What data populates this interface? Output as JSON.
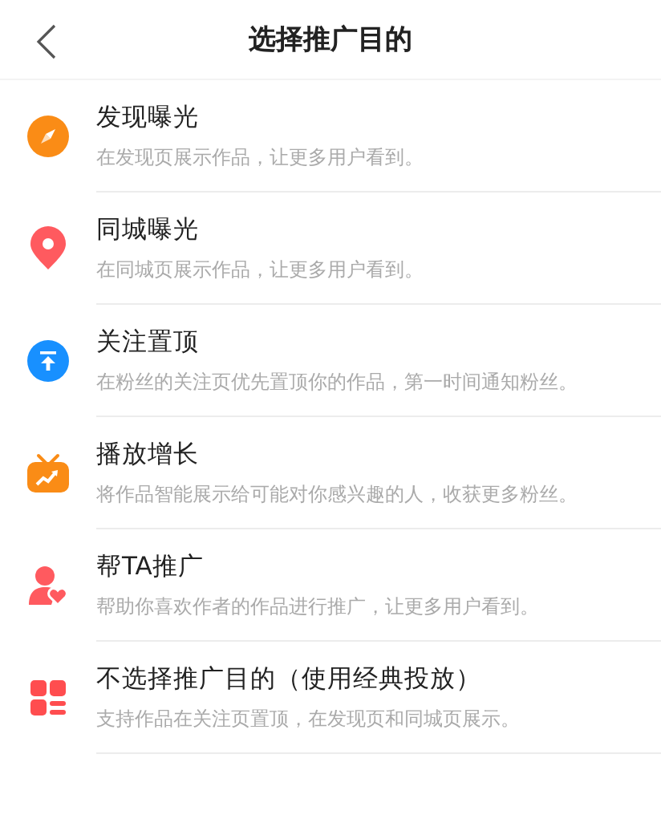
{
  "header": {
    "title": "选择推广目的"
  },
  "options": [
    {
      "kind": "compass",
      "title": "发现曝光",
      "description": "在发现页展示作品，让更多用户看到。"
    },
    {
      "kind": "pin",
      "title": "同城曝光",
      "description": "在同城页展示作品，让更多用户看到。"
    },
    {
      "kind": "top",
      "title": "关注置顶",
      "description": "在粉丝的关注页优先置顶你的作品，第一时间通知粉丝。"
    },
    {
      "kind": "tv",
      "title": "播放增长",
      "description": "将作品智能展示给可能对你感兴趣的人，收获更多粉丝。"
    },
    {
      "kind": "person",
      "title": "帮TA推广",
      "description": "帮助你喜欢作者的作品进行推广，让更多用户看到。"
    },
    {
      "kind": "grid",
      "title": "不选择推广目的（使用经典投放）",
      "description": "支持作品在关注页置顶，在发现页和同城页展示。"
    }
  ]
}
